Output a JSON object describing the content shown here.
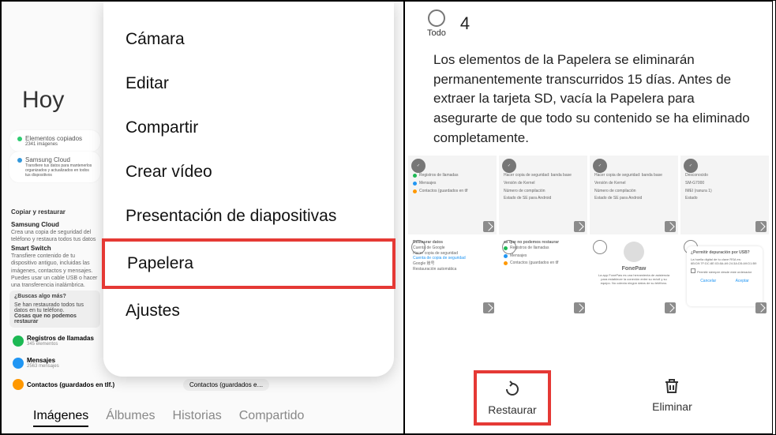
{
  "left": {
    "bg": {
      "title": "Hoy",
      "card1": "Elementos copiados",
      "card1_sub": "2341 imágenes",
      "card2": "Samsung Cloud",
      "card2_sub": "Transfiere tus datos para mantenerlos organizados y actualizados en todos tus dispositivos",
      "sec1": "Copiar y restaurar",
      "i1t": "Samsung Cloud",
      "i1s": "Crea una copia de seguridad del teléfono y restaura todos tus datos",
      "i2t": "Smart Switch",
      "i2s": "Transfiere contenido de tu dispositivo antiguo, incluidas las imágenes, contactos y mensajes. Puedes usar un cable USB o hacer una transferencia inalámbrica.",
      "prompt_q": "¿Buscas algo más?",
      "prompt_a1": "Se han restaurado todos tus datos en tu teléfono.",
      "prompt_a2": "Cosas que no podemos restaurar",
      "r1": "Registros de llamadas",
      "r1s": "345 elementos",
      "r2": "Mensajes",
      "r2s": "2563 mensajes",
      "r3": "Contactos (guardados en tlf.)",
      "chip": "Contactos (guardados e…"
    },
    "tabs": {
      "t1": "Imágenes",
      "t2": "Álbumes",
      "t3": "Historias",
      "t4": "Compartido"
    },
    "menu": {
      "m1": "Cámara",
      "m2": "Editar",
      "m3": "Compartir",
      "m4": "Crear vídeo",
      "m5": "Presentación de diapositivas",
      "m6": "Papelera",
      "m7": "Ajustes"
    }
  },
  "right": {
    "select_all": "Todo",
    "count": "4",
    "notice": "Los elementos de la Papelera se eliminarán permanentemente transcurridos 15 días. Antes de extraer la tarjeta SD, vacía la Papelera para asegurarte de que todo su contenido se ha eliminado completamente.",
    "thumbs": {
      "t1_a": "Registros de llamadas",
      "t1_b": "Mensajes",
      "t1_c": "Contactos (guardados en tlf",
      "t2_a": "Hacer copia de seguridad: banda base",
      "t2_b": "Versión de Kernel",
      "t2_c": "Número de compilación",
      "t2_d": "Estado de SE para Android",
      "t5_a": "Restaurar datos",
      "t5_b": "Cuenta de Google",
      "t5_c": "Hacer copia de seguridad",
      "t5_d": "Cuenta de copia de seguridad",
      "t5_e": "Google 账号",
      "t5_f": "Restauración automática",
      "t6_a": "as que no podemos restaurar",
      "t6_b": "Registros de llamadas",
      "t6_c": "Mensajes",
      "t6_d": "Contactos (guardados en tlf",
      "t7_a": "FonePaw",
      "t7_b": "La app FonePaw es una herramienta de asistencia para establecer la conexión entre su móvil y su equipo. No colecta ningún datos de su teléfono.",
      "t8_a": "¿Permitir depuración por USB?",
      "t8_b": "La huella digital de tu clave RSA es: 6B:D9:7F:DC:8E:03:8A:A9:24:3A:D5:A9:D1:B9",
      "t8_c": "Permitir siempre desde este ordenador",
      "t8_d": "Cancelar",
      "t8_e": "Aceptar"
    },
    "actions": {
      "restore": "Restaurar",
      "delete": "Eliminar"
    }
  }
}
